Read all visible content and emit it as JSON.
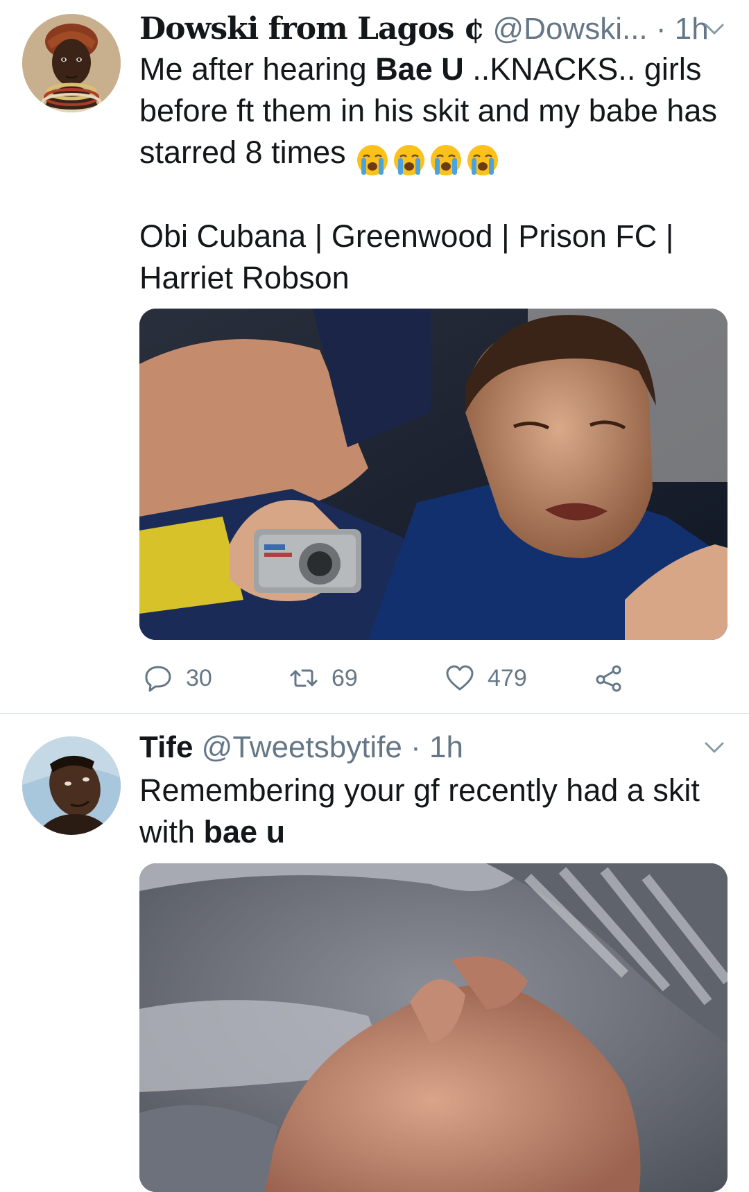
{
  "tweets": [
    {
      "display_name": "Dowski from Lagos ¢",
      "handle": "@Dowski...",
      "separator": "·",
      "time": "1h",
      "text_lines": [
        {
          "plain_before": "Me after hearing ",
          "bold": "Bae U",
          "plain_after": " ..KNACKS.. girls"
        },
        {
          "plain": "before ft them in his skit and my babe has"
        },
        {
          "plain": "starred 8 times "
        },
        {
          "plain": "Obi Cubana | Greenwood | Prison FC |"
        },
        {
          "plain": "Harriet Robson"
        }
      ],
      "emoji": [
        "crying-face",
        "crying-face",
        "crying-face",
        "crying-face"
      ],
      "stats": {
        "replies": "30",
        "retweets": "69",
        "likes": "479"
      }
    },
    {
      "display_name": "Tife",
      "handle": "@Tweetsbytife",
      "separator": "·",
      "time": "1h",
      "text_lines": [
        {
          "plain": "Remembering your gf recently had a skit"
        },
        {
          "plain_before": "with ",
          "bold": "bae u",
          "plain_after": ""
        }
      ]
    }
  ],
  "icons": {
    "reply": "reply-icon",
    "retweet": "retweet-icon",
    "like": "heart-icon",
    "share": "share-icon",
    "caret": "chevron-down-icon"
  },
  "colors": {
    "secondary_text": "#657786",
    "divider": "#e1e8ed"
  }
}
